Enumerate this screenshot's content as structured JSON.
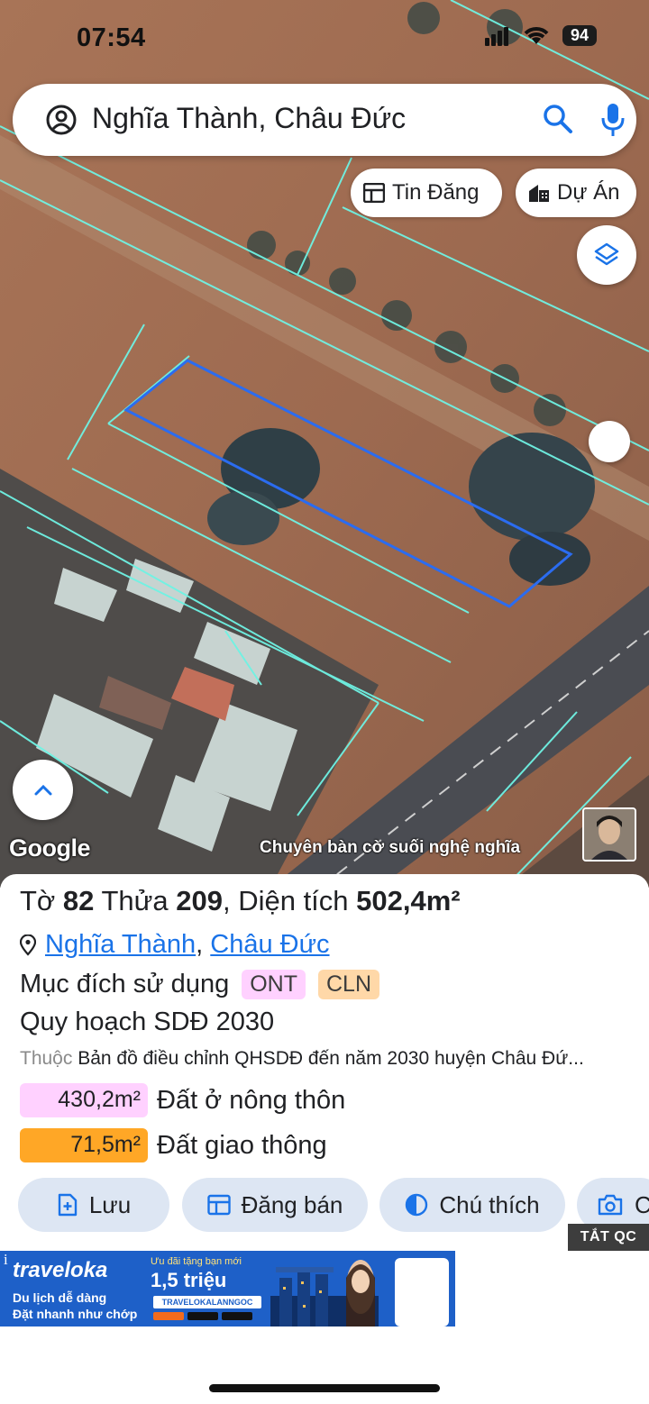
{
  "status_bar": {
    "time": "07:54",
    "battery": "94"
  },
  "search": {
    "query": "Nghĩa Thành, Châu Đức"
  },
  "chips": {
    "tin_dang": "Tin Đăng",
    "du_an": "Dự Án"
  },
  "map": {
    "attribution": "Google",
    "watermark": "Chuyên bàn cờ suối nghệ nghĩa"
  },
  "parcel": {
    "to_label": "Tờ",
    "to_value": "82",
    "thua_label": "Thửa",
    "thua_value": "209",
    "dien_tich_label": ", Diện tích",
    "dien_tich_value": "502,4m²",
    "commune": "Nghĩa Thành",
    "district": "Châu Đức",
    "purpose_label": "Mục đích sử dụng",
    "purpose_tags": [
      "ONT",
      "CLN"
    ],
    "plan_title": "Quy hoạch SDĐ 2030",
    "plan_source_prefix": "Thuộc",
    "plan_source": "Bản đồ điều chỉnh QHSDĐ đến năm 2030 huyện Châu Đứ...",
    "areas": [
      {
        "value": "430,2m²",
        "label": "Đất ở nông thôn",
        "color": "#ffd1ff"
      },
      {
        "value": "71,5m²",
        "label": "Đất giao thông",
        "color": "#ffa726"
      }
    ]
  },
  "actions": {
    "save": "Lưu",
    "post_sale": "Đăng bán",
    "legend": "Chú thích",
    "camera": "C"
  },
  "ad": {
    "close_label": "TẮT QC",
    "info": "i",
    "brand": "traveloka",
    "tagline_1": "Du lịch dễ dàng",
    "tagline_2": "Đặt nhanh như chớp",
    "offer_small": "Ưu đãi tặng bạn mới",
    "offer_big": "1,5 triệu",
    "promo_code": "TRAVELOKALANNGOC"
  },
  "colors": {
    "accent": "#1a73e8",
    "parcel_outline": "#2b6cf0",
    "boundary_lines": "#6ff3e4"
  }
}
